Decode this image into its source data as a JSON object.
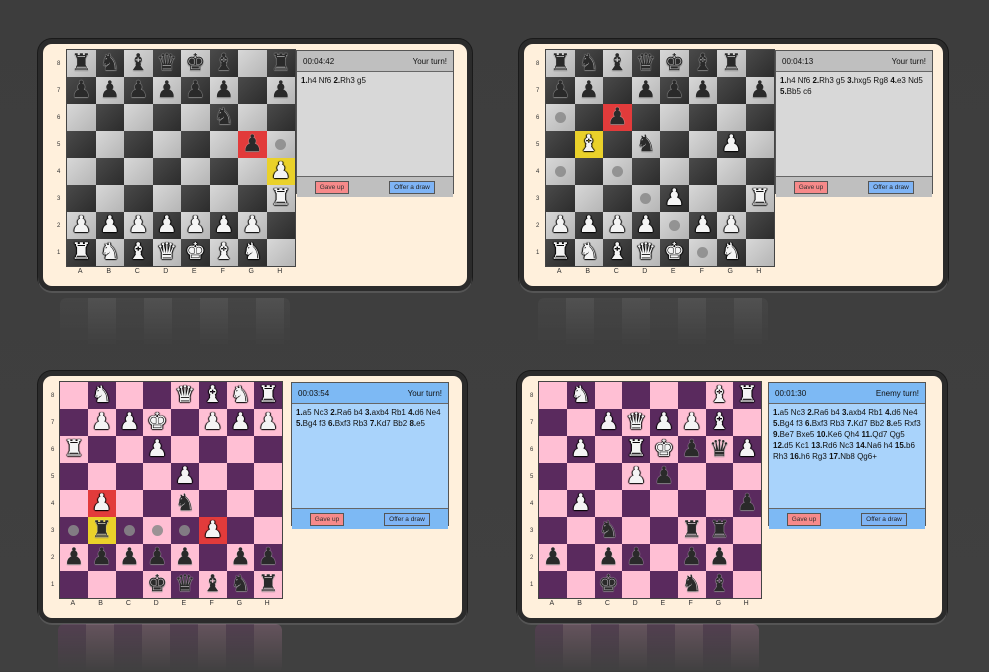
{
  "files": [
    "A",
    "B",
    "C",
    "D",
    "E",
    "F",
    "G",
    "H"
  ],
  "ranks": [
    "8",
    "7",
    "6",
    "5",
    "4",
    "3",
    "2",
    "1"
  ],
  "games": [
    {
      "theme": "stone",
      "time": "00:04:42",
      "turn": "Your turn!",
      "moves_html": "<b>1.</b>h4 Nf6 <b>2.</b>Rh3 g5",
      "give_up": "Gave up",
      "offer_draw": "Offer a draw",
      "board": [
        [
          "br",
          "bn",
          "bb",
          "bq",
          "bk",
          "bb",
          "",
          "br"
        ],
        [
          "bp",
          "bp",
          "bp",
          "bp",
          "bp",
          "bp",
          "",
          "bp"
        ],
        [
          "",
          "",
          "",
          "",
          "",
          "bn",
          "",
          ""
        ],
        [
          "",
          "",
          "",
          "",
          "",
          "",
          "bp",
          "."
        ],
        [
          "",
          "",
          "",
          "",
          "",
          "",
          "",
          "wp"
        ],
        [
          "",
          "",
          "",
          "",
          "",
          "",
          "",
          "wr"
        ],
        [
          "wp",
          "wp",
          "wp",
          "wp",
          "wp",
          "wp",
          "wp",
          ""
        ],
        [
          "wr",
          "wn",
          "wb",
          "wq",
          "wk",
          "wb",
          "wn",
          ""
        ]
      ],
      "red": [
        [
          3,
          6
        ]
      ],
      "yellow": [
        [
          4,
          7
        ]
      ]
    },
    {
      "theme": "stone",
      "time": "00:04:13",
      "turn": "Your turn!",
      "moves_html": "<b>1.</b>h4 Nf6 <b>2.</b>Rh3 g5 <b>3.</b>hxg5 Rg8 <b>4.</b>e3 Nd5 <b>5.</b>Bb5 c6",
      "give_up": "Gave up",
      "offer_draw": "Offer a draw",
      "board": [
        [
          "br",
          "bn",
          "bb",
          "bq",
          "bk",
          "bb",
          "br",
          ""
        ],
        [
          "bp",
          "bp",
          "",
          "bp",
          "bp",
          "bp",
          "",
          "bp"
        ],
        [
          ".",
          "",
          "bp",
          "",
          "",
          "",
          "",
          ""
        ],
        [
          "",
          "wb",
          "",
          "bn",
          "",
          "",
          "wp",
          ""
        ],
        [
          ".",
          "",
          ".",
          " ",
          "",
          "",
          "",
          ""
        ],
        [
          "",
          "",
          "",
          ".",
          "wp",
          "",
          "",
          "wr"
        ],
        [
          "wp",
          "wp",
          "wp",
          "wp",
          ".",
          "wp",
          "wp",
          ""
        ],
        [
          "wr",
          "wn",
          "wb",
          "wq",
          "wk",
          ".",
          "wn",
          ""
        ]
      ],
      "red": [
        [
          2,
          2
        ]
      ],
      "yellow": [
        [
          3,
          1
        ]
      ]
    },
    {
      "theme": "pink",
      "time": "00:03:54",
      "turn": "Your turn!",
      "moves_html": "<b>1.</b>a5 Nc3 <b>2.</b>Ra6 b4 <b>3.</b>axb4 Rb1 <b>4.</b>d6 Ne4 <b>5.</b>Bg4 f3 <b>6.</b>Bxf3 Rb3 <b>7.</b>Kd7 Bb2 <b>8.</b>e5",
      "give_up": "Gave up",
      "offer_draw": "Offer a draw",
      "board": [
        [
          "",
          "wn",
          "",
          "",
          "wq",
          "wb",
          "wn",
          "wr"
        ],
        [
          "",
          "wp",
          "wp",
          "wk",
          "",
          "wp",
          "wp",
          "wp"
        ],
        [
          "wr",
          "",
          "",
          "wp",
          "",
          "",
          "",
          ""
        ],
        [
          "",
          "",
          "",
          "",
          "wp",
          "",
          "",
          ""
        ],
        [
          "",
          "wp",
          "",
          "",
          "bn",
          "",
          "",
          ""
        ],
        [
          ".",
          "br",
          ".",
          ".",
          ".",
          "wp",
          "",
          ""
        ],
        [
          "bp",
          "bp",
          "bp",
          "bp",
          "bp",
          "",
          "bp",
          "bp"
        ],
        [
          "",
          "",
          "",
          "bk",
          "bq",
          "bb",
          "bn",
          "br"
        ]
      ],
      "red": [
        [
          4,
          1
        ],
        [
          5,
          5
        ]
      ],
      "yellow": [
        [
          5,
          1
        ]
      ]
    },
    {
      "theme": "pink",
      "time": "00:01:30",
      "turn": "Enemy turn!",
      "moves_html": "<b>1.</b>a5 Nc3 <b>2.</b>Ra6 b4 <b>3.</b>axb4 Rb1 <b>4.</b>d6 Ne4 <b>5.</b>Bg4 f3 <b>6.</b>Bxf3 Rb3 <b>7.</b>Kd7 Bb2 <b>8.</b>e5 Rxf3 <b>9.</b>Be7 Bxe5 <b>10.</b>Ke6 Qh4 <b>11.</b>Qd7 Qg5 <b>12.</b>d5 Kc1 <b>13.</b>Rd6 Nc3 <b>14.</b>Na6 h4 <b>15.</b>b6 Rh3 <b>16.</b>h6 Rg3 <b>17.</b>Nb8 Qg6+",
      "give_up": "Gave up",
      "offer_draw": "Offer a draw",
      "board": [
        [
          "",
          "wn",
          "",
          "",
          "",
          "",
          "wb",
          "wr"
        ],
        [
          "",
          "",
          "wp",
          "wq",
          "wp",
          "wp",
          "wb",
          ""
        ],
        [
          "",
          "wp",
          "",
          "wr",
          "wk",
          "bp",
          "bq",
          "wp"
        ],
        [
          "",
          "",
          "",
          "wp",
          "bp",
          "",
          "",
          ""
        ],
        [
          "",
          "wp",
          "",
          "",
          "",
          "",
          "",
          "bp"
        ],
        [
          "",
          "",
          "bn",
          "",
          "",
          "br",
          "br",
          ""
        ],
        [
          "bp",
          "",
          "bp",
          "bp",
          "",
          "bp",
          "bp",
          ""
        ],
        [
          "",
          "",
          "bk",
          "",
          "",
          "bn",
          "bb",
          ""
        ]
      ],
      "red": [],
      "yellow": []
    }
  ],
  "glyphs": {
    "k": "♚",
    "q": "♛",
    "r": "♜",
    "b": "♝",
    "n": "♞",
    "p": "♟"
  }
}
